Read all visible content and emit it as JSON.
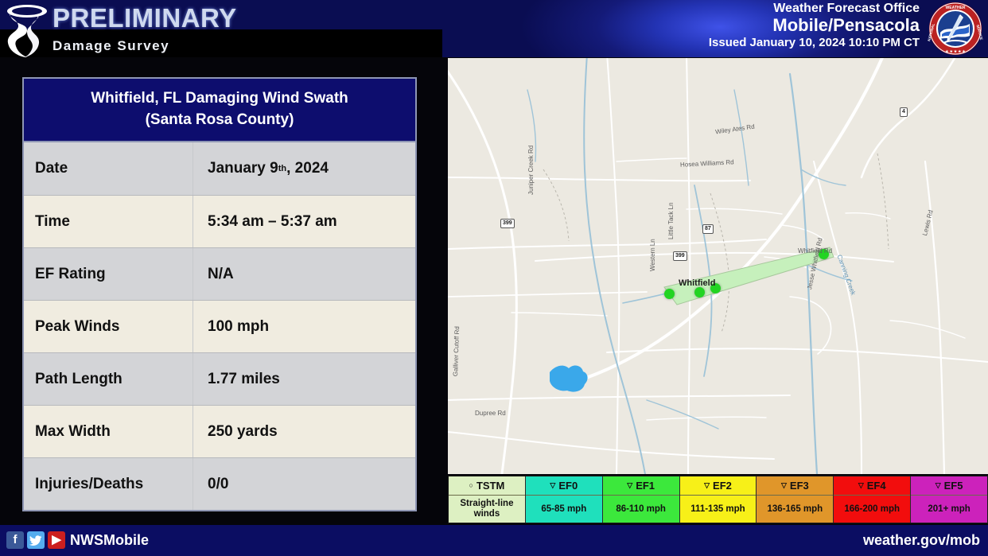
{
  "header": {
    "brand_title": "PRELIMINARY",
    "brand_subtitle": "Damage Survey",
    "tornado_icon": "tornado-icon",
    "wfo_line1": "Weather Forecast Office",
    "wfo_line2": "Mobile/Pensacola",
    "wfo_line3": "Issued January 10, 2024 10:10 PM CT",
    "seal_icon": "nws-seal-icon",
    "seal_text": "NATIONAL WEATHER SERVICE",
    "accent_navy": "#0a0d52",
    "accent_glow": "#3f52e8"
  },
  "panel": {
    "title_line1": "Whitfield, FL Damaging Wind Swath",
    "title_line2": "(Santa Rosa County)",
    "title_bg": "#0d0d6e",
    "rows": [
      {
        "key": "Date",
        "value": "January 9",
        "sup": "th",
        "value_tail": ", 2024"
      },
      {
        "key": "Time",
        "value": "5:34 am – 5:37 am",
        "sup": "",
        "value_tail": ""
      },
      {
        "key": "EF Rating",
        "value": "N/A",
        "sup": "",
        "value_tail": ""
      },
      {
        "key": "Peak Winds",
        "value": "100 mph",
        "sup": "",
        "value_tail": ""
      },
      {
        "key": "Path Length",
        "value": "1.77 miles",
        "sup": "",
        "value_tail": ""
      },
      {
        "key": "Max Width",
        "value": "250 yards",
        "sup": "",
        "value_tail": ""
      },
      {
        "key": "Injuries/Deaths",
        "value": "0/0",
        "sup": "",
        "value_tail": ""
      }
    ]
  },
  "map": {
    "city_label": "Whitfield",
    "swath_color": "#c6f0bc",
    "damage_point_color": "#22d422",
    "damage_points": 4,
    "road_labels": [
      "Wiley Ates Rd",
      "Hosea Williams Rd",
      "Little Tack Ln",
      "Juniper Creek Rd",
      "Western Ln",
      "Dupree Rd",
      "Whitfield Rd",
      "Jesse Whitfield Rd",
      "Lewis Rd",
      "Galliver Cutoff Rd"
    ],
    "water_labels": [
      "Canning Creek"
    ],
    "route_shields": [
      "399",
      "399",
      "87",
      "4"
    ]
  },
  "legend": {
    "columns": [
      {
        "label": "TSTM",
        "marker": "circle",
        "range": "Straight-line winds",
        "head_bg": "#ddf0c2",
        "body_bg": "#ddf0c2"
      },
      {
        "label": "EF0",
        "marker": "triangle",
        "range": "65-85 mph",
        "head_bg": "#1fe0bc",
        "body_bg": "#1fe0bc"
      },
      {
        "label": "EF1",
        "marker": "triangle",
        "range": "86-110 mph",
        "head_bg": "#3ce83c",
        "body_bg": "#3ce83c"
      },
      {
        "label": "EF2",
        "marker": "triangle",
        "range": "111-135 mph",
        "head_bg": "#f7f018",
        "body_bg": "#f7f018"
      },
      {
        "label": "EF3",
        "marker": "triangle",
        "range": "136-165 mph",
        "head_bg": "#e0962a",
        "body_bg": "#e0962a"
      },
      {
        "label": "EF4",
        "marker": "triangle",
        "range": "166-200 mph",
        "head_bg": "#f20d0d",
        "body_bg": "#f20d0d"
      },
      {
        "label": "EF5",
        "marker": "triangle",
        "range": "201+ mph",
        "head_bg": "#cc22bb",
        "body_bg": "#cc22bb"
      }
    ]
  },
  "footer": {
    "handle": "NWSMobile",
    "weblink": "weather.gov/mob",
    "facebook_glyph": "f",
    "twitter_glyph": "ᵗ",
    "youtube_glyph": "▶",
    "bar_color": "#0b0d62"
  }
}
